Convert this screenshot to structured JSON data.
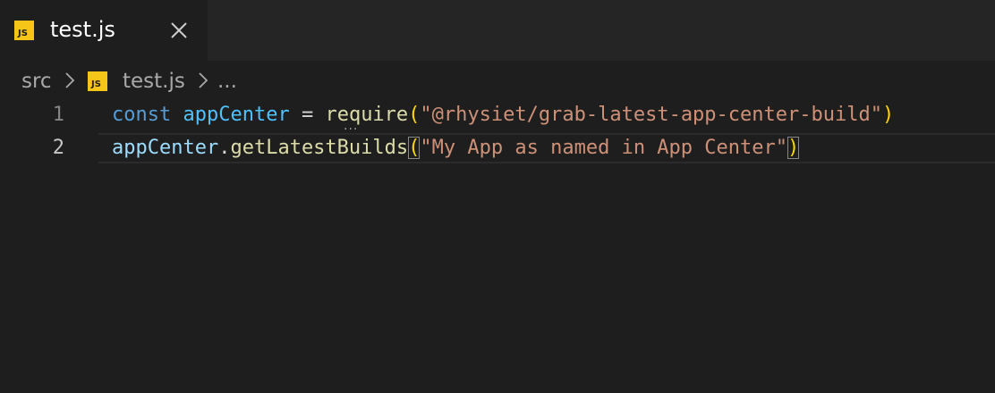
{
  "tab": {
    "icon": "javascript-file-icon",
    "icon_text": "JS",
    "title": "test.js",
    "close_icon": "close-icon"
  },
  "breadcrumb": {
    "folder": "src",
    "file_icon": "javascript-file-icon",
    "file_icon_text": "JS",
    "file": "test.js",
    "symbol": "..."
  },
  "editor": {
    "lines": [
      {
        "number": "1",
        "tokens": [
          "const",
          " ",
          "appCenter",
          " = ",
          "require",
          "(",
          "\"@rhysiet/grab-latest-app-center-build\"",
          ")"
        ]
      },
      {
        "number": "2",
        "tokens": [
          "appCenter",
          ".",
          "getLatestBuilds",
          "(",
          "\"My App as named in App Center\"",
          ")"
        ]
      }
    ],
    "active_line": "2",
    "hint_indicator": "..."
  },
  "colors": {
    "keyword": "#569cd6",
    "constant": "#4fc1ff",
    "variable": "#9cdcfe",
    "function": "#dcdcaa",
    "string": "#ce9178",
    "bracket": "#ffd700",
    "editor_background": "#1e1e1e",
    "js_icon": "#f5c518"
  }
}
